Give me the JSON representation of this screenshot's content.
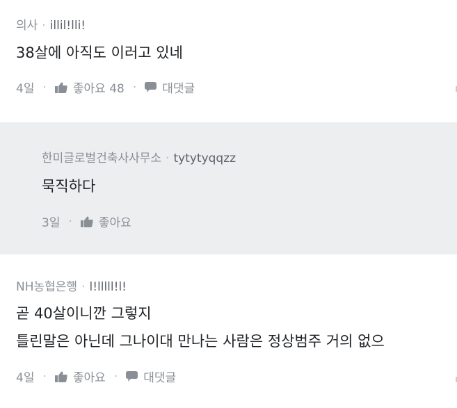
{
  "comments": [
    {
      "company": "의사",
      "username": "illil!lli!",
      "lines": [
        "38살에 아직도 이러고 있네"
      ],
      "date": "4일",
      "like_label": "좋아요 48",
      "reply_label": "대댓글"
    },
    {
      "company": "한미글로벌건축사사무소",
      "username": "tytytyqqzz",
      "lines": [
        "묵직하다"
      ],
      "date": "3일",
      "like_label": "좋아요"
    },
    {
      "company": "NH농협은행",
      "username": "l!lllll!l!",
      "lines": [
        "곧 40살이니깐 그렇지",
        "틀린말은 아닌데 그나이대 만나는 사람은 정상범주 거의 없으"
      ],
      "date": "4일",
      "like_label": "좋아요",
      "reply_label": "대댓글"
    }
  ],
  "separator": "·",
  "icons": {
    "like": "thumbs-up-icon",
    "reply": "speech-bubble-icon"
  },
  "colors": {
    "reply_background": "#eceef0",
    "meta_text": "#8a8f96",
    "body_text": "#1f2226"
  }
}
